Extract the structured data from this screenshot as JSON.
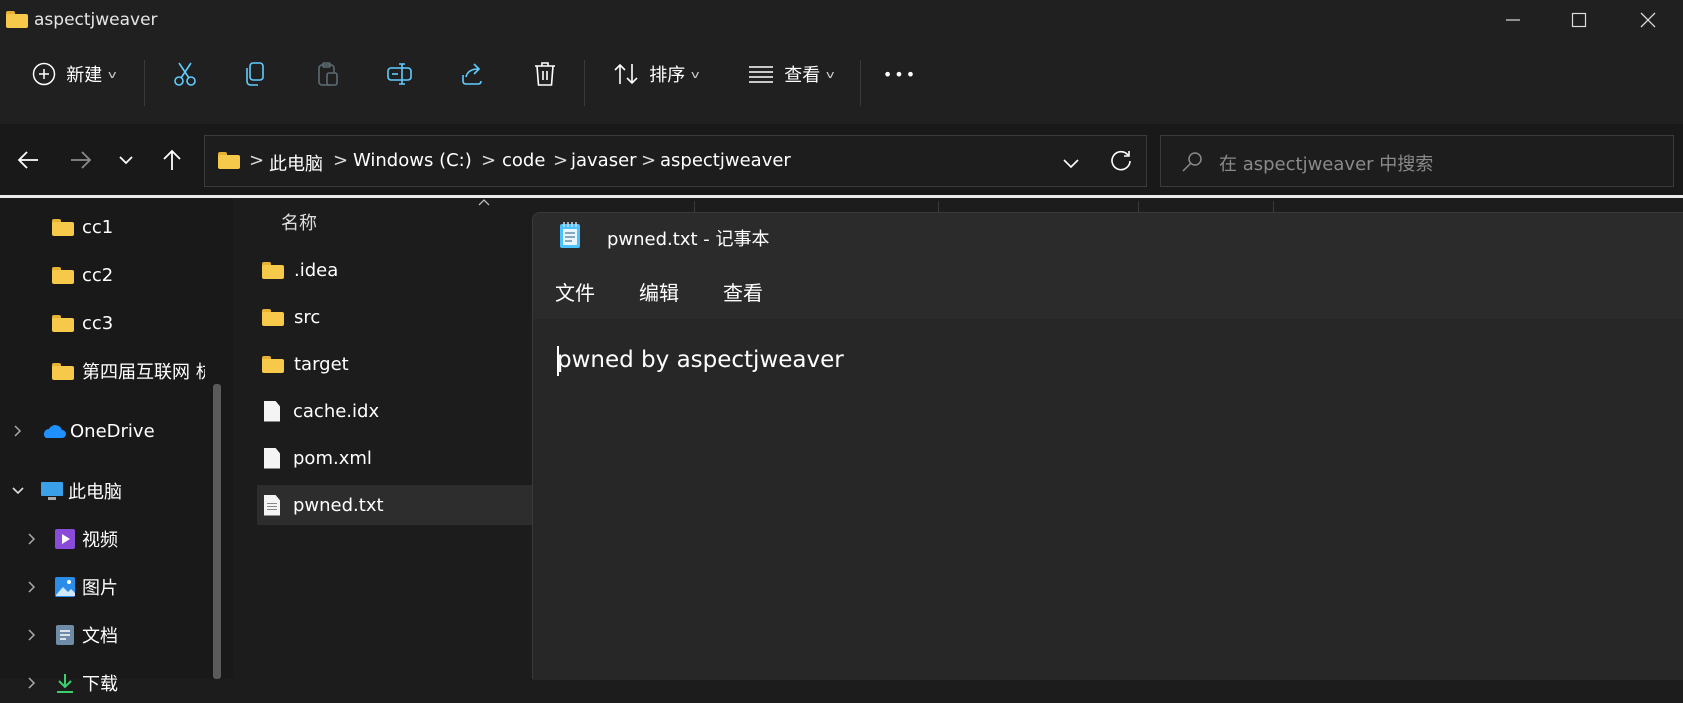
{
  "window": {
    "title": "aspectjweaver"
  },
  "toolbar": {
    "new_label": "新建",
    "sort_label": "排序",
    "view_label": "查看",
    "more": "•••"
  },
  "address": {
    "crumbs": [
      "此电脑",
      "Windows (C:)",
      "code",
      "javaser",
      "aspectjweaver"
    ],
    "separator": ">"
  },
  "search": {
    "placeholder": "在 aspectjweaver 中搜索"
  },
  "sidebar": {
    "items": [
      {
        "label": "cc1",
        "icon": "folder-icon"
      },
      {
        "label": "cc2",
        "icon": "folder-icon"
      },
      {
        "label": "cc3",
        "icon": "folder-icon"
      },
      {
        "label": "第四届互联网 杭",
        "icon": "folder-icon"
      },
      {
        "label": "OneDrive",
        "icon": "onedrive-icon"
      },
      {
        "label": "此电脑",
        "icon": "pc-icon"
      },
      {
        "label": "视频",
        "icon": "video-icon"
      },
      {
        "label": "图片",
        "icon": "pictures-icon"
      },
      {
        "label": "文档",
        "icon": "documents-icon"
      },
      {
        "label": "下载",
        "icon": "downloads-icon"
      }
    ]
  },
  "files": {
    "column_name": "名称",
    "rows": [
      {
        "name": ".idea",
        "type": "folder"
      },
      {
        "name": "src",
        "type": "folder"
      },
      {
        "name": "target",
        "type": "folder"
      },
      {
        "name": "cache.idx",
        "type": "file"
      },
      {
        "name": "pom.xml",
        "type": "file"
      },
      {
        "name": "pwned.txt",
        "type": "txt"
      }
    ]
  },
  "notepad": {
    "title": "pwned.txt - 记事本",
    "menu": [
      "文件",
      "编辑",
      "查看"
    ],
    "content": "pwned by aspectjweaver"
  },
  "colors": {
    "accent": "#4cc2ff",
    "folder": "#f7c94a"
  }
}
